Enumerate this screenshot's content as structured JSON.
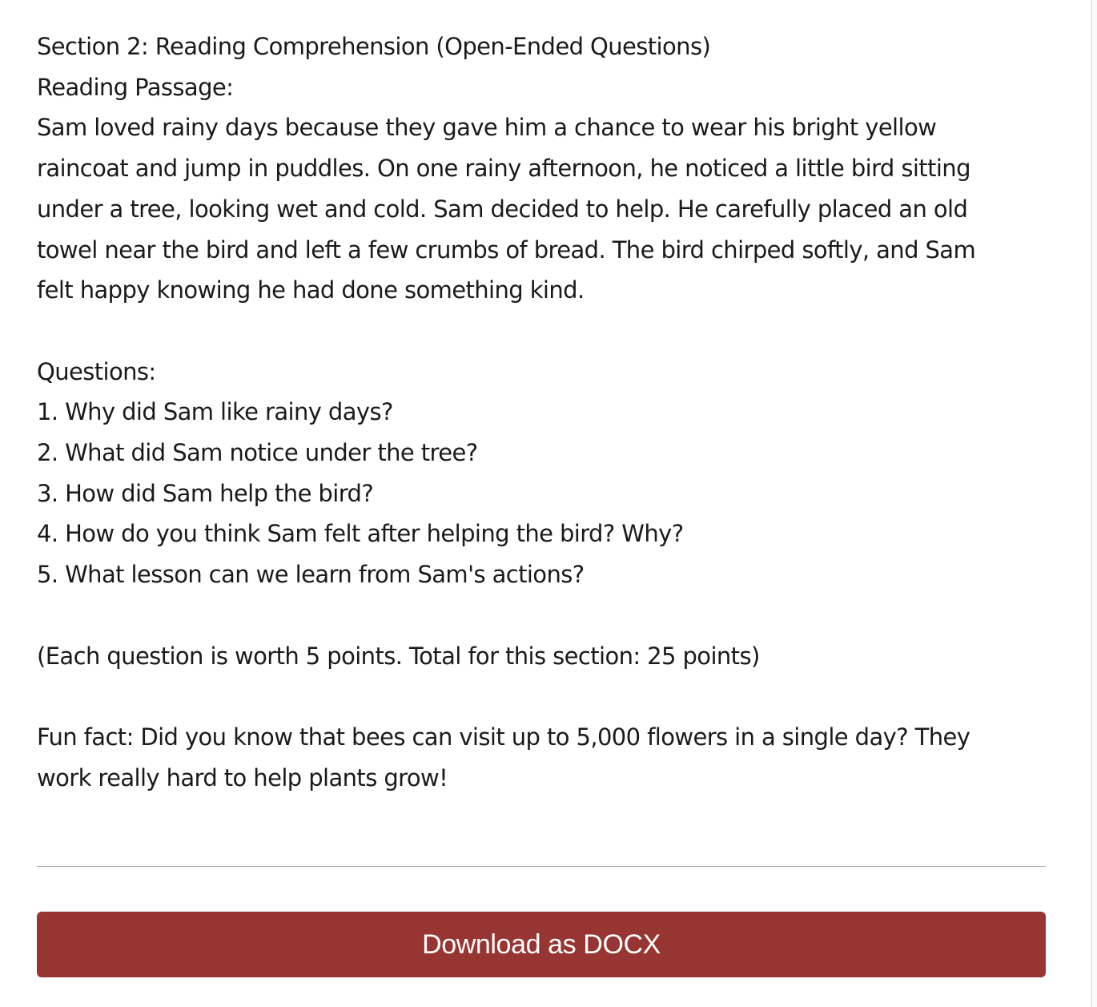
{
  "section": {
    "title": "Section 2: Reading Comprehension (Open-Ended Questions)",
    "passage_label": "Reading Passage:",
    "passage_lines": [
      "Sam loved rainy days because they gave him a chance to wear his bright yellow",
      "raincoat and jump in puddles. On one rainy afternoon, he noticed a little bird sitting",
      "under a tree, looking wet and cold. Sam decided to help. He carefully placed an old",
      "towel near the bird and left a few crumbs of bread. The bird chirped softly, and Sam",
      "felt happy knowing he had done something kind."
    ],
    "questions_label": "Questions:",
    "questions": [
      "1. Why did Sam like rainy days?",
      "2. What did Sam notice under the tree?",
      "3. How did Sam help the bird?",
      "4. How do you think Sam felt after helping the bird? Why?",
      "5. What lesson can we learn from Sam's actions?"
    ],
    "points_note": "(Each question is worth 5 points. Total for this section: 25 points)",
    "fun_fact_lines": [
      "Fun fact: Did you know that bees can visit up to 5,000 flowers in a single day? They",
      "work really hard to help plants grow!"
    ]
  },
  "actions": {
    "download_label": "Download as DOCX",
    "download_color": "#963531"
  }
}
